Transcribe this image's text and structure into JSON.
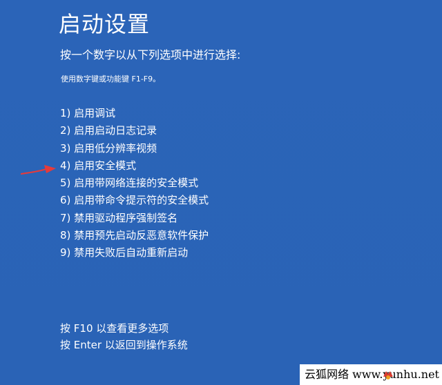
{
  "title": "启动设置",
  "prompt": "按一个数字以从下列选项中进行选择:",
  "hint": "使用数字键或功能键 F1-F9。",
  "options": [
    "1) 启用调试",
    "2) 启用启动日志记录",
    "3) 启用低分辨率视频",
    "4) 启用安全模式",
    "5) 启用带网络连接的安全模式",
    "6) 启用带命令提示符的安全模式",
    "7) 禁用驱动程序强制签名",
    "8) 禁用预先启动反恶意软件保护",
    "9) 禁用失败后自动重新启动"
  ],
  "footer": {
    "more_options": "按 F10 以查看更多选项",
    "return_os": "按 Enter 以返回到操作系统"
  },
  "watermark": {
    "text": "云狐网络 www.yunhu.net"
  },
  "colors": {
    "background": "#2a63b6",
    "text": "#ffffff",
    "arrow": "#e63b3b",
    "watermark_background": "#ffffff",
    "watermark_text": "#000000"
  },
  "icons": {
    "annotation_arrow": "red-arrow-icon",
    "watermark_logo": "fox-logo-icon"
  }
}
